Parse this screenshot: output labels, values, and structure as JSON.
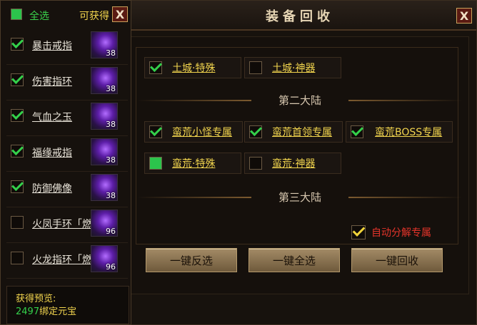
{
  "window": {
    "title": "装备回收",
    "close": "X"
  },
  "section2": "第二大陆",
  "section3": "第三大陆",
  "options_top": [
    {
      "label": "土城·特殊",
      "state": "checked"
    },
    {
      "label": "土城·神器",
      "state": "unchecked"
    }
  ],
  "options_mid": [
    {
      "label": "蛮荒小怪专属",
      "state": "checked"
    },
    {
      "label": "蛮荒首领专属",
      "state": "checked"
    },
    {
      "label": "蛮荒BOSS专属",
      "state": "checked"
    }
  ],
  "options_mid2": [
    {
      "label": "蛮荒·特殊",
      "state": "filled"
    },
    {
      "label": "蛮荒·神器",
      "state": "unchecked"
    }
  ],
  "auto": {
    "label": "自动分解专属",
    "checked": true
  },
  "buttons": {
    "invert": "一键反选",
    "select_all": "一键全选",
    "recycle": "一键回收"
  },
  "panel": {
    "select_all": "全选",
    "obtainable": "可获得",
    "close": "X",
    "items": [
      {
        "name": "暴击戒指",
        "count": "38",
        "checked": true
      },
      {
        "name": "伤害指环",
        "count": "38",
        "checked": true
      },
      {
        "name": "气血之玉",
        "count": "38",
        "checked": true
      },
      {
        "name": "福缘戒指",
        "count": "38",
        "checked": true
      },
      {
        "name": "防御佛像",
        "count": "38",
        "checked": true
      },
      {
        "name": "火凤手环「燃",
        "count": "96",
        "checked": false
      },
      {
        "name": "火龙指环「燃",
        "count": "96",
        "checked": false
      }
    ],
    "preview_label": "获得预览:",
    "preview_amount": "2497",
    "preview_unit": "绑定元宝"
  },
  "colors": {
    "accent_yellow": "#f2d54e",
    "check_green": "#34d04b",
    "auto_red": "#e4342a"
  }
}
